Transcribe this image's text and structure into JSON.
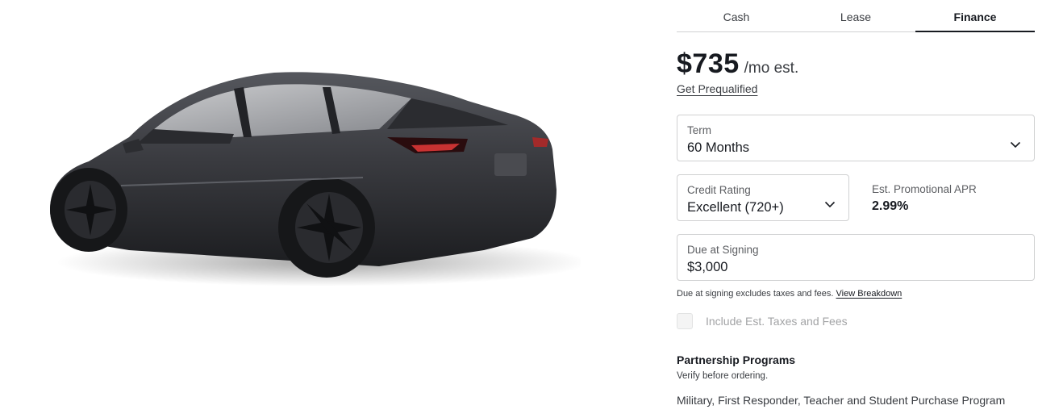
{
  "tabs": [
    {
      "label": "Cash",
      "active": false
    },
    {
      "label": "Lease",
      "active": false
    },
    {
      "label": "Finance",
      "active": true
    }
  ],
  "price": {
    "amount": "$735",
    "suffix": "/mo est."
  },
  "prequalify_link": "Get Prequalified",
  "term": {
    "label": "Term",
    "value": "60 Months"
  },
  "credit_rating": {
    "label": "Credit Rating",
    "value": "Excellent (720+)"
  },
  "apr": {
    "label": "Est. Promotional APR",
    "value": "2.99%"
  },
  "due_at_signing": {
    "label": "Due at Signing",
    "value": "$3,000"
  },
  "signing_note": {
    "text": "Due at signing excludes taxes and fees.",
    "link": "View Breakdown"
  },
  "taxes_checkbox": {
    "label": "Include Est. Taxes and Fees",
    "checked": false
  },
  "partnership": {
    "title": "Partnership Programs",
    "subtitle": "Verify before ordering.",
    "program": "Military, First Responder, Teacher and Student Purchase Program"
  },
  "car_image": {
    "icon": "car-rear-three-quarter-image",
    "paint_color": "#3a3b40"
  }
}
